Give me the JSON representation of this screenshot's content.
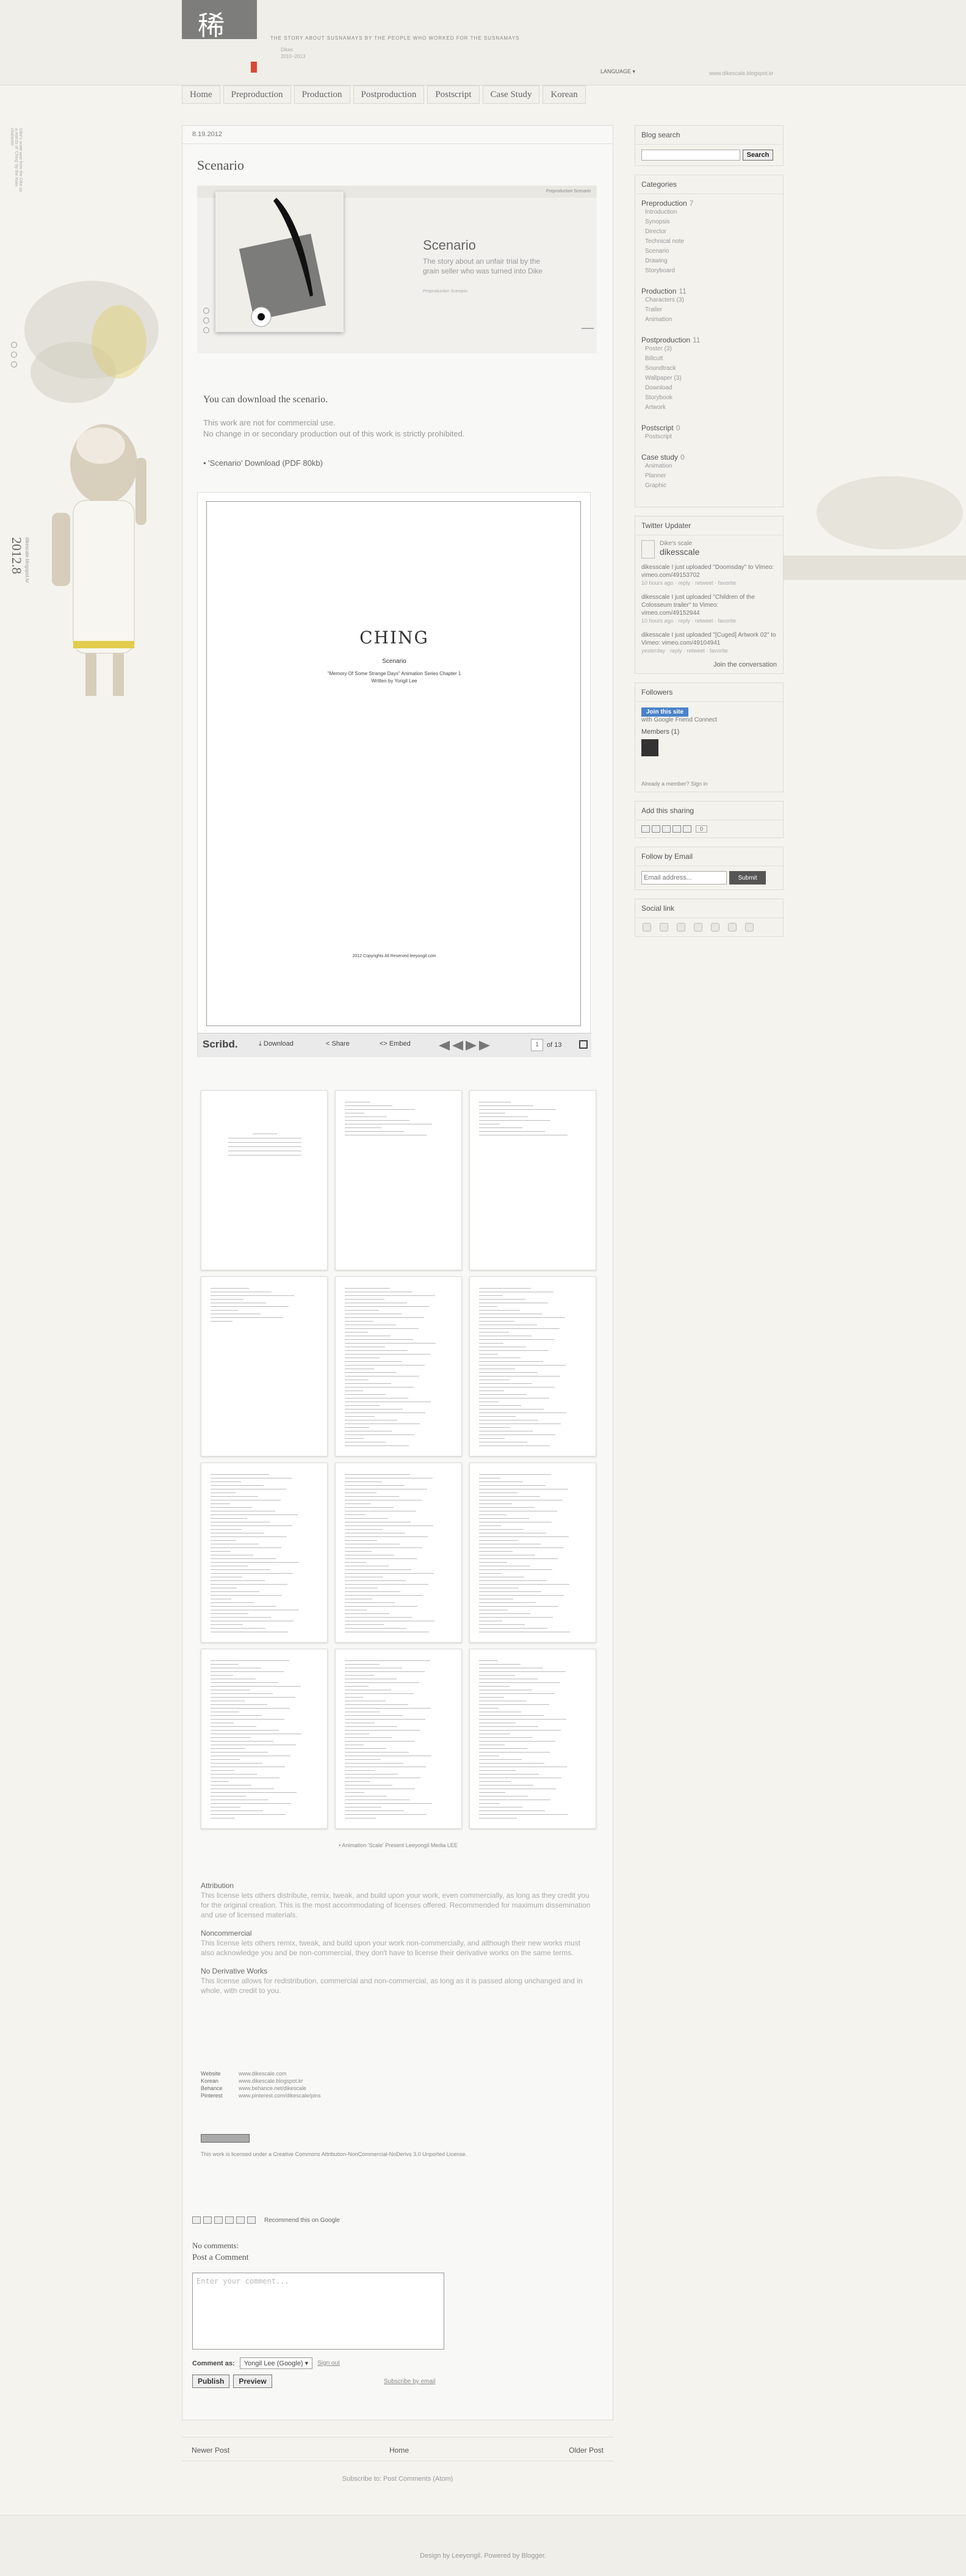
{
  "header": {
    "tagline": "THE STORY ABOUT SUSNAMAYS BY THE PEOPLE WHO WORKED FOR THE SUSNAMAYS",
    "meta": [
      "Dikes",
      "2010~2013"
    ],
    "language": "LANGUAGE ▾",
    "blog_url": "www.dikescale.blogspot.kr",
    "logo_glyph": "稀"
  },
  "nav": [
    "Home",
    "Preproduction",
    "Production",
    "Postproduction",
    "Postscript",
    "Case Study",
    "Korean"
  ],
  "sidebar_left": {
    "note": "Dike's scale was from the Dike as a rejects of 'Ching' by the main character",
    "year": "2012.8",
    "year_sub": "dikescale.blogspot.kr"
  },
  "post": {
    "date": "8.19.2012",
    "title": "Scenario",
    "hero_links": "Preproduction  Scenario",
    "hero_heading": "Scenario",
    "hero_text": "The story about an unfair trial by the grain seller who was turned into Dike",
    "hero_small": "Preproduction  Scenario",
    "download_heading": "You can download the scenario.",
    "download_notes": [
      "This work are not for commercial use.",
      "No change in or secondary production out of this work is strictly prohibited."
    ],
    "download_link": "• 'Scenario' Download   (PDF 80kb)"
  },
  "viewer": {
    "title": "CHING",
    "subtitle": "Scenario",
    "line1": "\"Memory Of Some Strange Days\" Animation Series Chapter 1",
    "line2": "Written by Yongil Lee",
    "copyright": "2012 Copyrights All Reserved leeyongil.com",
    "logo": "Scribd.",
    "download": "⤓ Download",
    "share": "< Share",
    "embed": "<> Embed",
    "page": "1",
    "of": "of 13"
  },
  "caption": "• Animation 'Scale' Present Leeyongil Media LEE",
  "license": [
    {
      "title": "Attribution",
      "text": "This license lets others distribute, remix, tweak, and build upon your work, even commercially, as long as they credit you for the original creation. This is the most accommodating of licenses offered. Recommended for maximum dissemination and use of licensed materials."
    },
    {
      "title": "Noncommercial",
      "text": "This license lets others remix, tweak, and build upon your work non-commercially, and although their new works must also acknowledge you and be non-commercial, they don't have to license their derivative works on the same terms."
    },
    {
      "title": "No Derivative Works",
      "text": "This license allows for redistribution, commercial and non-commercial, as long as it is passed along unchanged and in whole, with credit to you."
    }
  ],
  "links": [
    [
      "Website",
      "www.dikescale.com"
    ],
    [
      "Korean",
      "www.dikescale.blogspot.kr"
    ],
    [
      "Behance",
      "www.behance.net/dikescale"
    ],
    [
      "Pinterest",
      "www.pinterest.com/dikescale/pins"
    ]
  ],
  "cc_text": "This work is licensed under a Creative Commons Attribution-NonCommercial-NoDerivs 3.0 Unported License.",
  "comments": {
    "share_label": "Recommend this on Google",
    "no_comments": "No comments:",
    "post_heading": "Post a Comment",
    "placeholder": "Enter your comment...",
    "comment_as": "Comment as:",
    "account": "Yongil Lee (Google) ▾",
    "signout": "Sign out",
    "publish": "Publish",
    "preview": "Preview",
    "subscribe": "Subscribe by email"
  },
  "pager": {
    "newer": "Newer Post",
    "home": "Home",
    "older": "Older Post"
  },
  "subscribe_posts": "Subscribe to: Post Comments (Atom)",
  "footer": "Design by Leeyongil. Powered by Blogger.",
  "sidebar": {
    "search_title": "Blog search",
    "search_button": "Search",
    "categories_title": "Categories",
    "categories": [
      {
        "name": "Preproduction",
        "count": "7",
        "items": [
          "Introduction",
          "Synopsis",
          "Director",
          "Technical note",
          "Scenario",
          "Drawing",
          "Storyboard"
        ]
      },
      {
        "name": "Production",
        "count": "11",
        "items": [
          "Characters (3)",
          "Trailer",
          "Animation"
        ]
      },
      {
        "name": "Postproduction",
        "count": "11",
        "items": [
          "Poster (3)",
          "Billcutt",
          "Soundtrack",
          "Wallpaper (3)",
          "Download",
          "Storybook",
          "Artwork"
        ]
      },
      {
        "name": "Postscript",
        "count": "0",
        "items": [
          "Postscript"
        ]
      },
      {
        "name": "Case study",
        "count": "0",
        "items": [
          "Animation",
          "Planner",
          "Graphic"
        ]
      }
    ],
    "twitter_title": "Twitter Updater",
    "twitter_user": "Dike's scale",
    "twitter_handle": "dikesscale",
    "tweets": [
      {
        "text": "dikesscale I just uploaded \"Doomsday\" to Vimeo: vimeo.com/49153702",
        "ts": "10 hours ago · reply · retweet · favorite"
      },
      {
        "text": "dikesscale I just uploaded \"Children of the Colosseum trailer\" to Vimeo: vimeo.com/49152944",
        "ts": "10 hours ago · reply · retweet · favorite"
      },
      {
        "text": "dikesscale I just uploaded \"[Cuged] Artwork 02\" to Vimeo: vimeo.com/49104941",
        "ts": "yesterday · reply · retweet · favorite"
      }
    ],
    "join_conversation": "Join the conversation",
    "followers_title": "Followers",
    "join_site": "Join this site",
    "gfc": "with Google Friend Connect",
    "members": "Members (1)",
    "already_member": "Already a member? Sign in",
    "sharing_title": "Add this sharing",
    "sharing_count": "0",
    "follow_title": "Follow by Email",
    "email_placeholder": "Email address...",
    "email_button": "Submit",
    "social_title": "Social link"
  }
}
